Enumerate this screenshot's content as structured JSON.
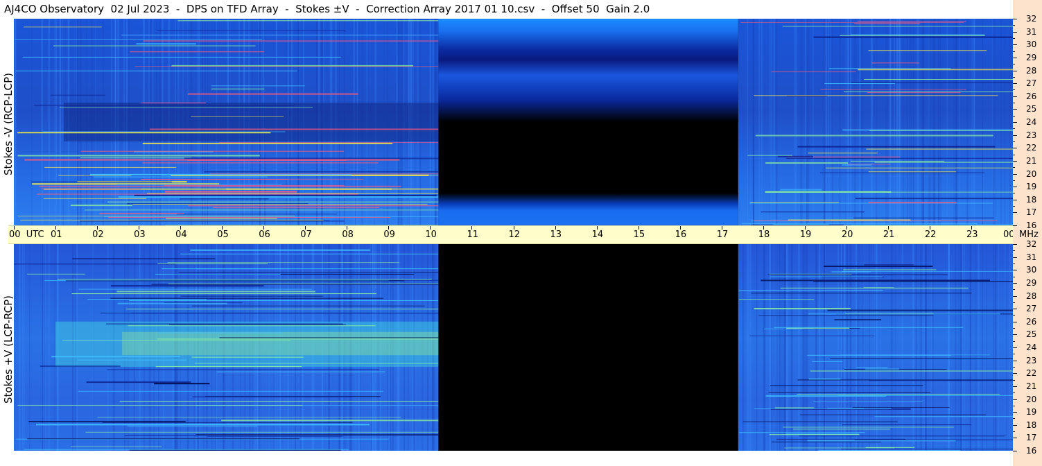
{
  "title": "AJ4CO Observatory  02 Jul 2023  -  DPS on TFD Array  -  Stokes ±V  -  Correction Array 2017 01 10.csv  -  Offset 50  Gain 2.0",
  "chart_data": [
    {
      "type": "heatmap",
      "panel": "top",
      "ylabel": "Stokes -V (RCP-LCP)",
      "x_axis": {
        "unit": "UTC",
        "range_hours": [
          0,
          24
        ]
      },
      "y_axis": {
        "unit": "MHz",
        "range": [
          16,
          32
        ]
      },
      "data_gap_hours": [
        10.2,
        17.4
      ],
      "colormap": [
        "#000000",
        "#0b1f8c",
        "#1f4fe0",
        "#2f8bff",
        "#3fc0ff",
        "#8cf0a0",
        "#f5e84a"
      ],
      "description_bands": "bright interference lines concentrated near 16-21 MHz and 27 MHz"
    },
    {
      "type": "heatmap",
      "panel": "bottom",
      "ylabel": "Stokes +V (LCP-RCP)",
      "x_axis": {
        "unit": "UTC",
        "range_hours": [
          0,
          24
        ]
      },
      "y_axis": {
        "unit": "MHz",
        "range": [
          16,
          32
        ]
      },
      "data_gap_hours": [
        10.2,
        17.4
      ]
    }
  ],
  "x_ticks": [
    "00  UTC",
    "01",
    "02",
    "03",
    "04",
    "05",
    "06",
    "07",
    "08",
    "09",
    "10",
    "11",
    "12",
    "13",
    "14",
    "15",
    "16",
    "17",
    "18",
    "19",
    "20",
    "21",
    "22",
    "23",
    "00"
  ],
  "freq_unit": "MHz",
  "freq_ticks": [
    "32",
    "31",
    "30",
    "29",
    "28",
    "27",
    "26",
    "25",
    "24",
    "23",
    "22",
    "21",
    "20",
    "19",
    "18",
    "17",
    "16"
  ]
}
